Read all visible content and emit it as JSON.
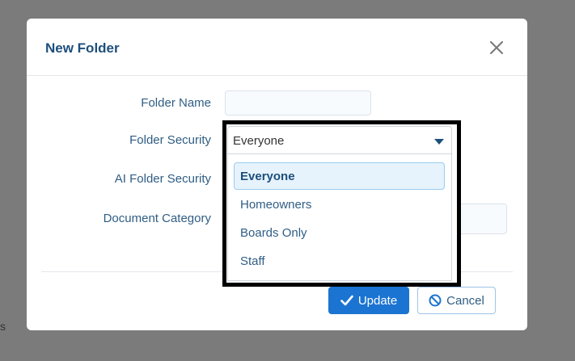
{
  "background": {
    "fragment_text": "s"
  },
  "modal": {
    "title": "New Folder",
    "close_icon": "close-icon"
  },
  "form": {
    "folder_name": {
      "label": "Folder Name",
      "value": "",
      "placeholder": ""
    },
    "folder_security": {
      "label": "Folder Security",
      "selected": "Everyone",
      "options": [
        "Everyone",
        "Homeowners",
        "Boards Only",
        "Staff"
      ]
    },
    "ai_folder_security": {
      "label": "AI Folder Security"
    },
    "document_category": {
      "label": "Document Category",
      "value": ""
    }
  },
  "buttons": {
    "update_label": "Update",
    "update_icon": "check-icon",
    "cancel_label": "Cancel",
    "cancel_icon": "ban-icon"
  },
  "colors": {
    "primary": "#1b74d1",
    "title": "#1d4f7c",
    "label": "#2f5d84",
    "highlight_border": "#000000"
  }
}
